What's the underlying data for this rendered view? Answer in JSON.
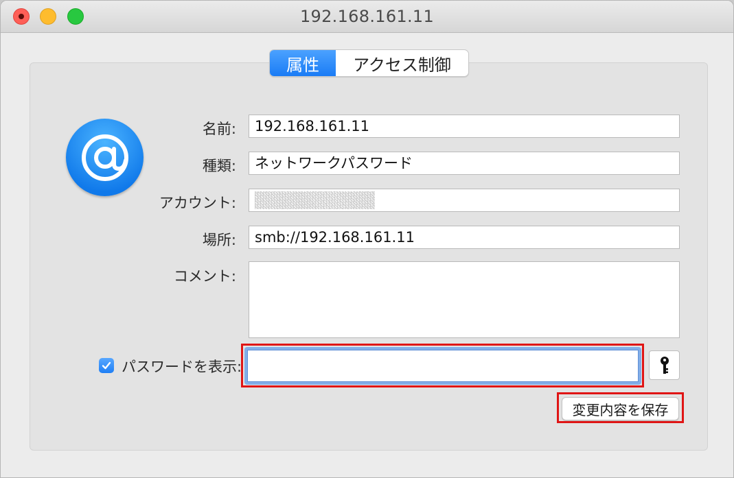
{
  "window": {
    "title": "192.168.161.11"
  },
  "tabs": [
    {
      "label": "属性",
      "selected": true
    },
    {
      "label": "アクセス制御",
      "selected": false
    }
  ],
  "form": {
    "name_label": "名前:",
    "name_value": "192.168.161.11",
    "kind_label": "種類:",
    "kind_value": "ネットワークパスワード",
    "account_label": "アカウント:",
    "account_value": "",
    "where_label": "場所:",
    "where_value": "smb://192.168.161.11",
    "comment_label": "コメント:",
    "comment_value": "",
    "show_password_label": "パスワードを表示:",
    "show_password_checked": true,
    "password_value": ""
  },
  "buttons": {
    "save_label": "変更内容を保存"
  },
  "colors": {
    "accent": "#1a7cf5",
    "highlight": "#e01515",
    "close": "#fe5f57",
    "minimize": "#febc2e",
    "maximize": "#28c840"
  },
  "icons": {
    "item_icon": "at-sign-icon",
    "password_assistant": "key-icon"
  }
}
